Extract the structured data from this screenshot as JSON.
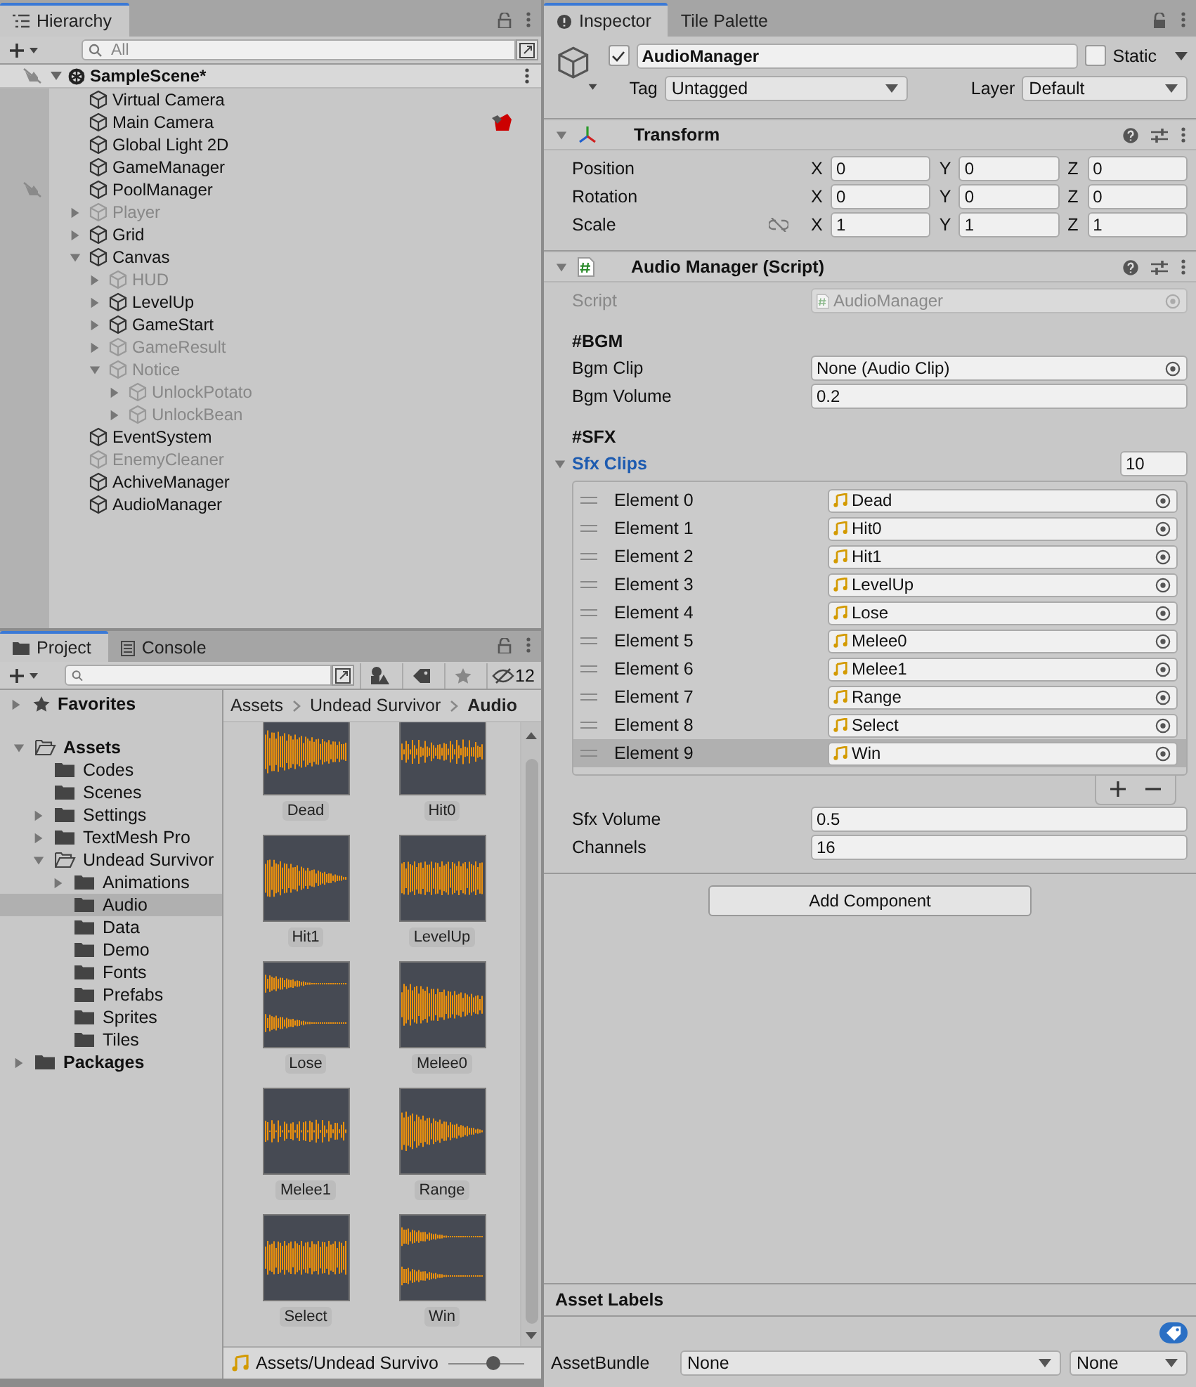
{
  "hierarchy": {
    "tabs": [
      {
        "label": "Hierarchy",
        "selected": true
      }
    ],
    "search": {
      "placeholder": "All"
    },
    "scene": {
      "name": "SampleScene*",
      "expanded": true,
      "hidden": true
    },
    "items": [
      {
        "name": "Virtual Camera",
        "active": true,
        "hidden": false,
        "gizmo": false,
        "selected": false
      },
      {
        "name": "Main Camera",
        "active": true,
        "hidden": false,
        "gizmo": true,
        "selected": false
      },
      {
        "name": "Global Light 2D",
        "active": true,
        "hidden": false,
        "gizmo": false,
        "selected": false
      },
      {
        "name": "GameManager",
        "active": true,
        "hidden": false,
        "gizmo": false,
        "selected": false
      },
      {
        "name": "PoolManager",
        "active": true,
        "hidden": true,
        "gizmo": false,
        "selected": false
      },
      {
        "name": "Player",
        "active": false,
        "hidden": false,
        "gizmo": false,
        "selected": false,
        "expanded": false
      },
      {
        "name": "Grid",
        "active": true,
        "hidden": false,
        "gizmo": false,
        "selected": false,
        "expanded": false
      },
      {
        "name": "Canvas",
        "active": true,
        "hidden": false,
        "gizmo": false,
        "selected": false,
        "expanded": true,
        "children": [
          {
            "name": "HUD",
            "active": false,
            "hidden": false,
            "gizmo": false,
            "selected": false,
            "expanded": false
          },
          {
            "name": "LevelUp",
            "active": true,
            "hidden": false,
            "gizmo": false,
            "selected": false,
            "expanded": false
          },
          {
            "name": "GameStart",
            "active": true,
            "hidden": false,
            "gizmo": false,
            "selected": false,
            "expanded": false
          },
          {
            "name": "GameResult",
            "active": false,
            "hidden": false,
            "gizmo": false,
            "selected": false,
            "expanded": false
          },
          {
            "name": "Notice",
            "active": false,
            "hidden": false,
            "gizmo": false,
            "selected": false,
            "expanded": true,
            "children": [
              {
                "name": "UnlockPotato",
                "active": false,
                "hidden": false,
                "gizmo": false,
                "selected": false,
                "expanded": false
              },
              {
                "name": "UnlockBean",
                "active": false,
                "hidden": false,
                "gizmo": false,
                "selected": false,
                "expanded": false
              }
            ]
          }
        ]
      },
      {
        "name": "EventSystem",
        "active": true,
        "hidden": false,
        "gizmo": false,
        "selected": false
      },
      {
        "name": "EnemyCleaner",
        "active": false,
        "hidden": false,
        "gizmo": false,
        "selected": false
      },
      {
        "name": "AchiveManager",
        "active": true,
        "hidden": false,
        "gizmo": false,
        "selected": false
      },
      {
        "name": "AudioManager",
        "active": true,
        "hidden": false,
        "gizmo": false,
        "selected": false
      }
    ]
  },
  "project": {
    "tabs": [
      {
        "label": "Project",
        "selected": true
      },
      {
        "label": "Console",
        "selected": false
      }
    ],
    "hidden_count": "12",
    "favorites": {
      "label": "Favorites",
      "expanded": false,
      "selected": false
    },
    "folders": [
      {
        "name": "Assets",
        "expanded": true,
        "selected": false,
        "children": [
          {
            "name": "Codes",
            "selected": false
          },
          {
            "name": "Scenes",
            "selected": false
          },
          {
            "name": "Settings",
            "expanded": false,
            "selected": false
          },
          {
            "name": "TextMesh Pro",
            "expanded": false,
            "selected": false
          },
          {
            "name": "Undead Survivor",
            "expanded": true,
            "selected": false,
            "children": [
              {
                "name": "Animations",
                "expanded": false,
                "selected": false
              },
              {
                "name": "Audio",
                "selected": true
              },
              {
                "name": "Data",
                "selected": false
              },
              {
                "name": "Demo",
                "selected": false
              },
              {
                "name": "Fonts",
                "selected": false
              },
              {
                "name": "Prefabs",
                "selected": false
              },
              {
                "name": "Sprites",
                "selected": false
              },
              {
                "name": "Tiles",
                "selected": false
              }
            ]
          }
        ]
      },
      {
        "name": "Packages",
        "expanded": false,
        "selected": false
      }
    ],
    "breadcrumb": [
      "Assets",
      "Undead Survivor",
      "Audio"
    ],
    "assets": [
      "Dead",
      "Hit0",
      "Hit1",
      "LevelUp",
      "Lose",
      "Melee0",
      "Melee1",
      "Range",
      "Select",
      "Win"
    ],
    "footer": {
      "path": "Assets/Undead Survivo",
      "zoom": {
        "level": 0.6
      }
    }
  },
  "inspector": {
    "tabs": [
      {
        "label": "Inspector",
        "selected": true
      },
      {
        "label": "Tile Palette",
        "selected": false
      }
    ],
    "object": {
      "active": true,
      "name": "AudioManager",
      "static": false,
      "static_label": "Static",
      "tag_label": "Tag",
      "tag": "Untagged",
      "layer_label": "Layer",
      "layer": "Default"
    },
    "components": [
      {
        "kind": "transform",
        "title": "Transform",
        "expanded": true,
        "rows": [
          {
            "label": "Position",
            "values": [
              {
                "axis": "X",
                "value": "0"
              },
              {
                "axis": "Y",
                "value": "0"
              },
              {
                "axis": "Z",
                "value": "0"
              }
            ]
          },
          {
            "label": "Rotation",
            "values": [
              {
                "axis": "X",
                "value": "0"
              },
              {
                "axis": "Y",
                "value": "0"
              },
              {
                "axis": "Z",
                "value": "0"
              }
            ]
          },
          {
            "label": "Scale",
            "proportions_locked": false,
            "values": [
              {
                "axis": "X",
                "value": "1"
              },
              {
                "axis": "Y",
                "value": "1"
              },
              {
                "axis": "Z",
                "value": "1"
              }
            ]
          }
        ]
      },
      {
        "kind": "script",
        "title": "Audio Manager (Script)",
        "expanded": true,
        "script": {
          "label": "Script",
          "value": "AudioManager"
        },
        "properties": [
          {
            "kind": "header",
            "label": "#BGM"
          },
          {
            "kind": "object",
            "label": "Bgm Clip",
            "value": "None (Audio Clip)"
          },
          {
            "kind": "field",
            "label": "Bgm Volume",
            "value": "0.2"
          },
          {
            "kind": "header",
            "label": "#SFX"
          },
          {
            "kind": "array",
            "label": "Sfx Clips",
            "expanded": true,
            "size": "10",
            "elements": [
              {
                "label": "Element 0",
                "value": "Dead",
                "selected": false
              },
              {
                "label": "Element 1",
                "value": "Hit0",
                "selected": false
              },
              {
                "label": "Element 2",
                "value": "Hit1",
                "selected": false
              },
              {
                "label": "Element 3",
                "value": "LevelUp",
                "selected": false
              },
              {
                "label": "Element 4",
                "value": "Lose",
                "selected": false
              },
              {
                "label": "Element 5",
                "value": "Melee0",
                "selected": false
              },
              {
                "label": "Element 6",
                "value": "Melee1",
                "selected": false
              },
              {
                "label": "Element 7",
                "value": "Range",
                "selected": false
              },
              {
                "label": "Element 8",
                "value": "Select",
                "selected": false
              },
              {
                "label": "Element 9",
                "value": "Win",
                "selected": true
              }
            ]
          },
          {
            "kind": "field",
            "label": "Sfx Volume",
            "value": "0.5"
          },
          {
            "kind": "field",
            "label": "Channels",
            "value": "16"
          }
        ]
      }
    ],
    "add_component": "Add Component",
    "asset_labels": {
      "title": "Asset Labels",
      "bundle_label": "AssetBundle",
      "bundle": "None",
      "variant": "None"
    }
  }
}
